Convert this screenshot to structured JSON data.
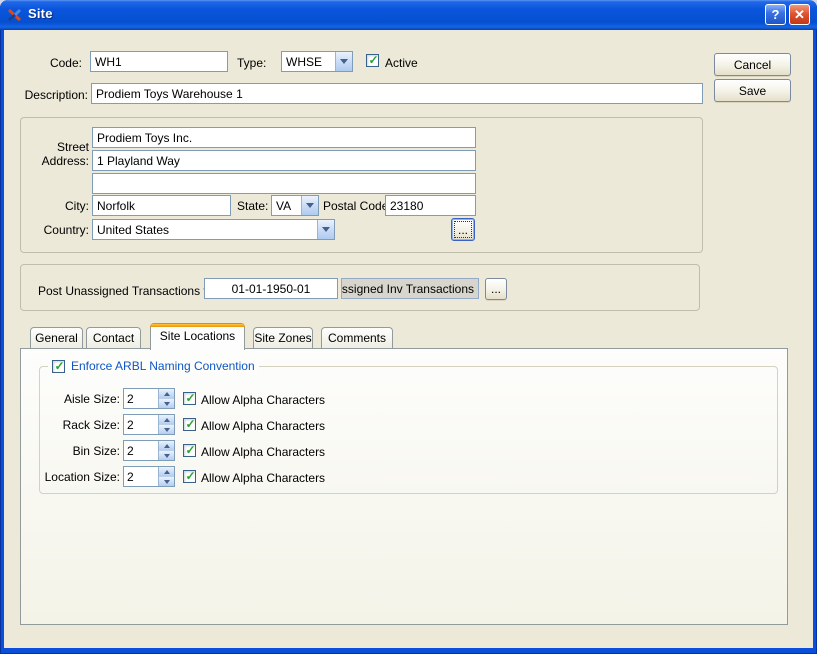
{
  "window": {
    "title": "Site",
    "help": "?",
    "close": "✕"
  },
  "buttons": {
    "cancel": "Cancel",
    "save": "Save"
  },
  "header": {
    "code_label": "Code:",
    "code_value": "WH1",
    "type_label": "Type:",
    "type_value": "WHSE",
    "active_label": "Active",
    "active_checked": true,
    "description_label": "Description:",
    "description_value": "Prodiem Toys Warehouse 1"
  },
  "address": {
    "street_label": "Street Address:",
    "line1": "Prodiem Toys Inc.",
    "line2": "1 Playland Way",
    "line3": "",
    "city_label": "City:",
    "city": "Norfolk",
    "state_label": "State:",
    "state": "VA",
    "postal_label": "Postal Code:",
    "postal": "23180",
    "country_label": "Country:",
    "country": "United States",
    "browse": "..."
  },
  "post": {
    "label": "Post Unassigned Transactions to:",
    "date_value": "01-01-1950-01",
    "account_value": "nassigned Inv Transactions",
    "browse": "..."
  },
  "tabs": [
    {
      "label": "General",
      "active": false
    },
    {
      "label": "Contact",
      "active": false
    },
    {
      "label": "Site Locations",
      "active": true
    },
    {
      "label": "Site Zones",
      "active": false
    },
    {
      "label": "Comments",
      "active": false
    }
  ],
  "locations": {
    "group_label": "Enforce ARBL Naming Convention",
    "group_checked": true,
    "rows": [
      {
        "label": "Aisle Size:",
        "value": "2",
        "allow": "Allow Alpha Characters",
        "checked": true
      },
      {
        "label": "Rack Size:",
        "value": "2",
        "allow": "Allow Alpha Characters",
        "checked": true
      },
      {
        "label": "Bin Size:",
        "value": "2",
        "allow": "Allow Alpha Characters",
        "checked": true
      },
      {
        "label": "Location Size:",
        "value": "2",
        "allow": "Allow Alpha Characters",
        "checked": true
      }
    ]
  }
}
